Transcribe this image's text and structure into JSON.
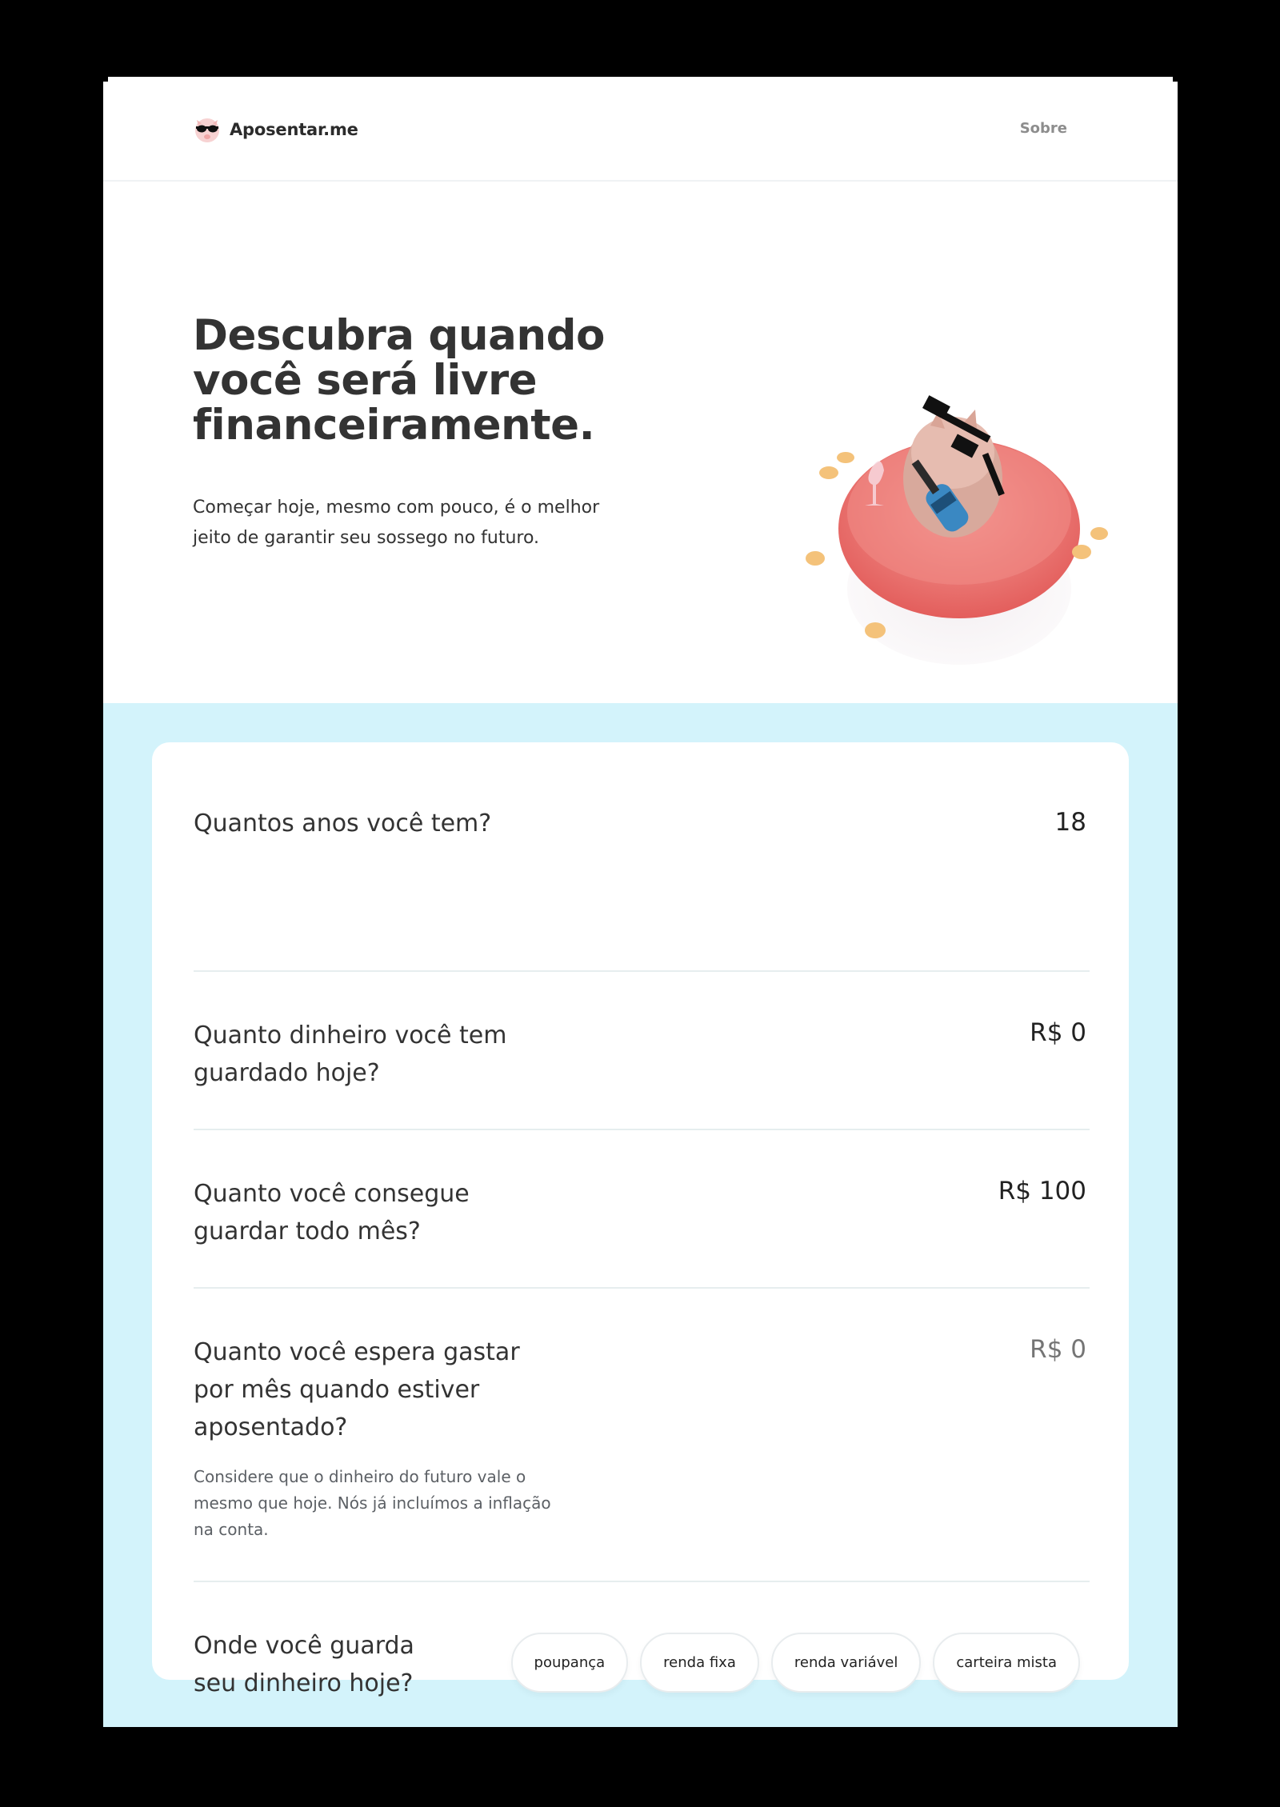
{
  "header": {
    "brand": "Aposentar.me",
    "nav_about": "Sobre"
  },
  "hero": {
    "title": "Descubra quando você será livre financeiramente.",
    "subtitle": "Começar hoje, mesmo com pouco, é o melhor jeito de garantir seu sossego no futuro."
  },
  "form": {
    "age": {
      "label": "Quantos anos você tem?",
      "value": "18"
    },
    "savings": {
      "label": "Quanto dinheiro você tem guardado hoje?",
      "value": "R$ 0"
    },
    "monthly": {
      "label": "Quanto você consegue guardar todo mês?",
      "value": "R$ 100"
    },
    "spending": {
      "label": "Quanto você espera gastar por mês quando estiver aposentado?",
      "placeholder": "R$ 0",
      "hint": "Considere que o dinheiro do futuro vale o mesmo que hoje. Nós já incluímos a inflação na conta."
    },
    "investment": {
      "label": "Onde você guarda seu dinheiro hoje?",
      "options": [
        "poupança",
        "renda fixa",
        "renda variável",
        "carteira mista"
      ]
    }
  },
  "colors": {
    "section_bg": "#d3f3fb",
    "float_red": "#e8615f",
    "coin": "#f4c27a"
  }
}
